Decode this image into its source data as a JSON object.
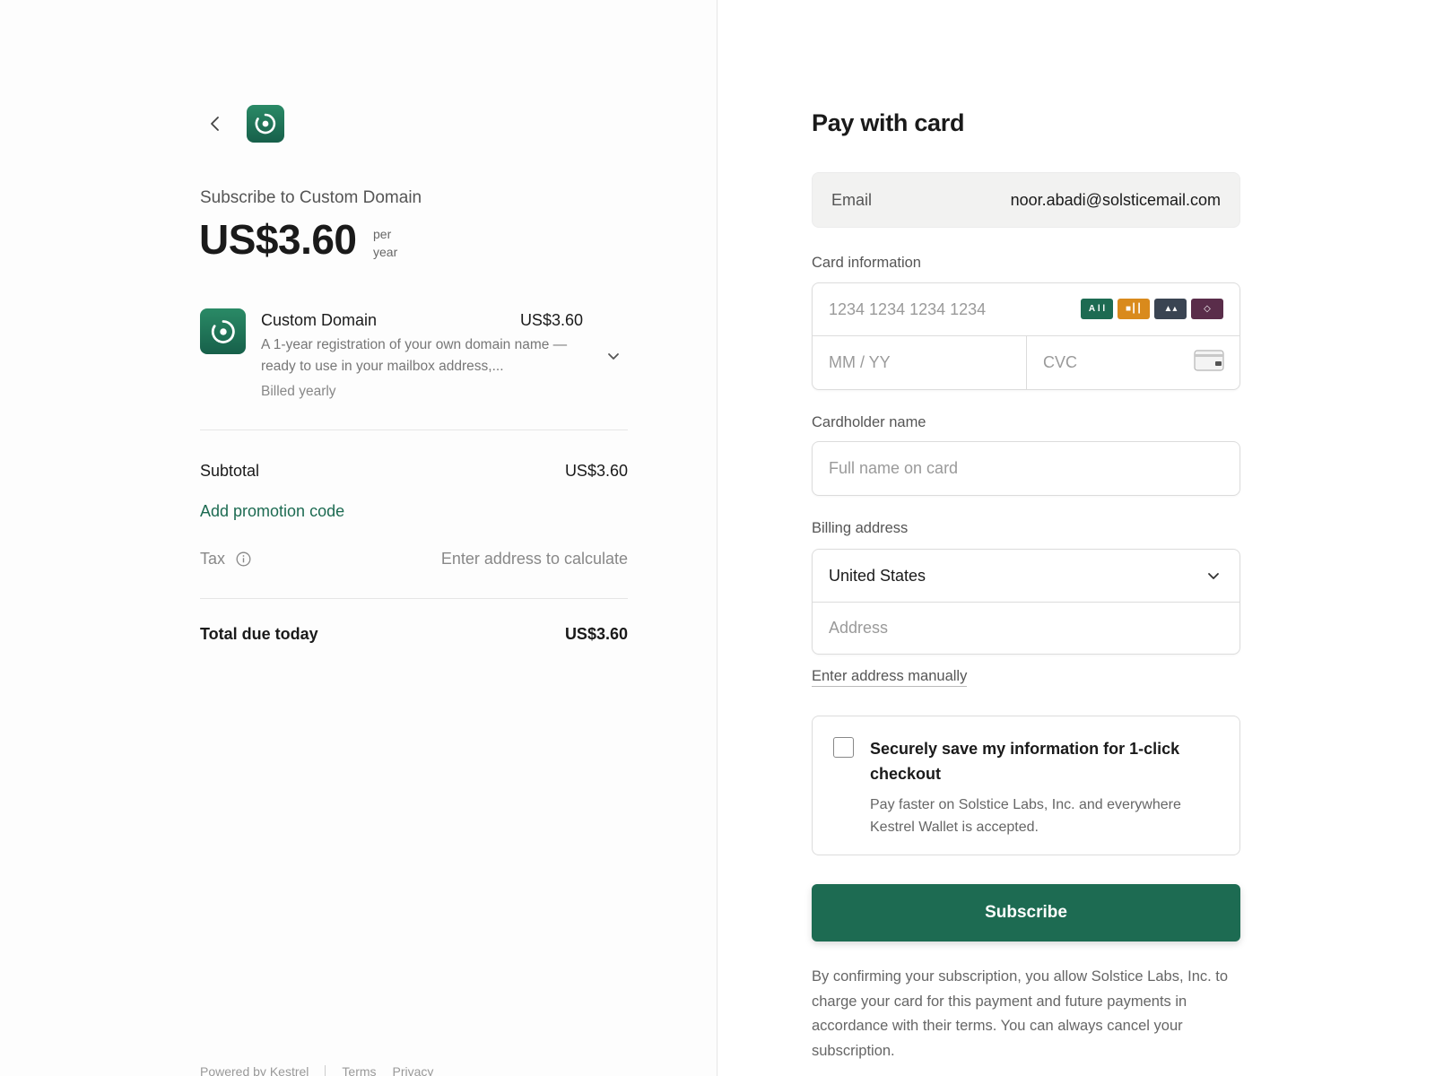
{
  "summary": {
    "subscribe_to": "Subscribe to Custom Domain",
    "price": "US$3.60",
    "period_line1": "per",
    "period_line2": "year",
    "item": {
      "name": "Custom Domain",
      "price": "US$3.60",
      "description": "A 1-year registration of your own domain name — ready to use in your mailbox address,...",
      "billing": "Billed yearly"
    },
    "subtotal_label": "Subtotal",
    "subtotal_value": "US$3.60",
    "promo_label": "Add promotion code",
    "tax_label": "Tax",
    "tax_value": "Enter address to calculate",
    "total_label": "Total due today",
    "total_value": "US$3.60",
    "footer": {
      "powered_by": "Powered by Kestrel",
      "terms": "Terms",
      "privacy": "Privacy"
    }
  },
  "payment": {
    "title": "Pay with card",
    "email_label": "Email",
    "email_value": "noor.abadi@solsticemail.com",
    "card_info_label": "Card information",
    "card_number_placeholder": "1234 1234 1234 1234",
    "card_brands": [
      {
        "name": "brand-1-icon",
        "color": "#1d6b52",
        "glyph": "A l l"
      },
      {
        "name": "brand-2-icon",
        "color": "#d98a1c",
        "glyph": "■┃┃"
      },
      {
        "name": "brand-3-icon",
        "color": "#3a4452",
        "glyph": "▲▴"
      },
      {
        "name": "brand-4-icon",
        "color": "#5a2d4a",
        "glyph": "◇"
      }
    ],
    "expiry_placeholder": "MM / YY",
    "cvc_placeholder": "CVC",
    "cardholder_label": "Cardholder name",
    "cardholder_placeholder": "Full name on card",
    "billing_label": "Billing address",
    "country_value": "United States",
    "address_placeholder": "Address",
    "manual_address_link": "Enter address manually",
    "save_info_title": "Securely save my information for 1-click checkout",
    "save_info_desc": "Pay faster on Solstice Labs, Inc. and everywhere Kestrel Wallet is accepted.",
    "subscribe_button": "Subscribe",
    "legal_text": "By confirming your subscription, you allow Solstice Labs, Inc. to charge your card for this payment and future payments in accordance with their terms. You can always cancel your subscription."
  },
  "colors": {
    "accent": "#1d6b52",
    "logo_gradient_top": "#2a8a66",
    "logo_gradient_bottom": "#17604a"
  }
}
